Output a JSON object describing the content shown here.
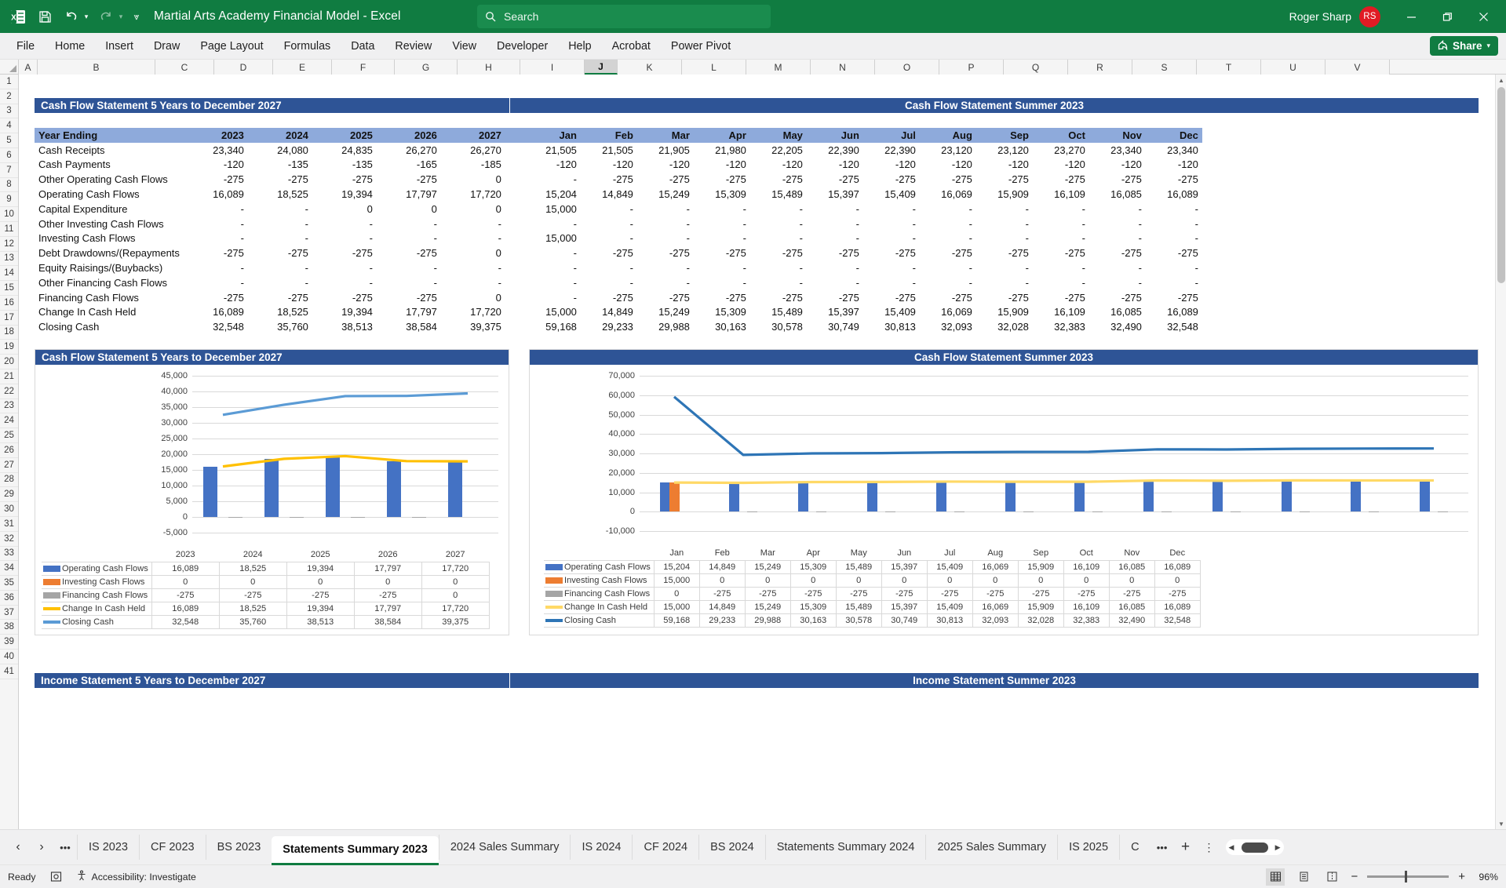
{
  "app": {
    "title": "Martial Arts Academy Financial Model  -  Excel",
    "search_placeholder": "Search",
    "user_name": "Roger Sharp",
    "user_initials": "RS",
    "qat": [
      "save-icon",
      "undo-icon",
      "redo-icon",
      "customize-icon"
    ],
    "window_buttons": [
      "minimize",
      "restore",
      "close"
    ]
  },
  "ribbon": {
    "tabs": [
      "File",
      "Home",
      "Insert",
      "Draw",
      "Page Layout",
      "Formulas",
      "Data",
      "Review",
      "View",
      "Developer",
      "Help",
      "Acrobat",
      "Power Pivot"
    ],
    "share_label": "Share"
  },
  "grid": {
    "columns": [
      "A",
      "B",
      "C",
      "D",
      "E",
      "F",
      "G",
      "H",
      "I",
      "J",
      "K",
      "L",
      "M",
      "N",
      "O",
      "P",
      "Q",
      "R",
      "S",
      "T",
      "U",
      "V"
    ],
    "selected_column": "J",
    "rows": [
      1,
      2,
      3,
      4,
      5,
      6,
      7,
      8,
      9,
      10,
      11,
      12,
      13,
      14,
      15,
      16,
      17,
      18,
      19,
      20,
      21,
      22,
      23,
      24,
      25,
      26,
      27,
      28,
      29,
      30,
      31,
      32,
      33,
      34,
      35,
      36,
      37,
      38,
      39,
      40,
      41
    ]
  },
  "banners": {
    "left_banner": "Cash Flow Statement 5 Years to December 2027",
    "right_banner": "Cash Flow Statement Summer 2023",
    "bottom_left_banner": "Income Statement 5 Years to December 2027",
    "bottom_right_banner": "Income Statement Summer 2023"
  },
  "table": {
    "header_label": "Year Ending",
    "year_columns": [
      "2023",
      "2024",
      "2025",
      "2026",
      "2027"
    ],
    "month_columns": [
      "Jan",
      "Feb",
      "Mar",
      "Apr",
      "May",
      "Jun",
      "Jul",
      "Aug",
      "Sep",
      "Oct",
      "Nov",
      "Dec"
    ],
    "rows": [
      {
        "label": "Cash Receipts",
        "years": [
          "23,340",
          "24,080",
          "24,835",
          "26,270",
          "26,270"
        ],
        "months": [
          "21,505",
          "21,505",
          "21,905",
          "21,980",
          "22,205",
          "22,390",
          "22,390",
          "23,120",
          "23,120",
          "23,270",
          "23,340",
          "23,340"
        ]
      },
      {
        "label": "Cash Payments",
        "years": [
          "-120",
          "-135",
          "-135",
          "-165",
          "-185"
        ],
        "months": [
          "-120",
          "-120",
          "-120",
          "-120",
          "-120",
          "-120",
          "-120",
          "-120",
          "-120",
          "-120",
          "-120",
          "-120"
        ]
      },
      {
        "label": "Other Operating Cash Flows",
        "years": [
          "-275",
          "-275",
          "-275",
          "-275",
          "0"
        ],
        "months": [
          "-",
          "-275",
          "-275",
          "-275",
          "-275",
          "-275",
          "-275",
          "-275",
          "-275",
          "-275",
          "-275",
          "-275"
        ]
      },
      {
        "label": "Operating Cash Flows",
        "years": [
          "16,089",
          "18,525",
          "19,394",
          "17,797",
          "17,720"
        ],
        "months": [
          "15,204",
          "14,849",
          "15,249",
          "15,309",
          "15,489",
          "15,397",
          "15,409",
          "16,069",
          "15,909",
          "16,109",
          "16,085",
          "16,089"
        ]
      },
      {
        "label": "Capital Expenditure",
        "years": [
          "-",
          "-",
          "0",
          "0",
          "0"
        ],
        "months": [
          "15,000",
          "-",
          "-",
          "-",
          "-",
          "-",
          "-",
          "-",
          "-",
          "-",
          "-",
          "-"
        ]
      },
      {
        "label": "Other Investing Cash Flows",
        "years": [
          "-",
          "-",
          "-",
          "-",
          "-"
        ],
        "months": [
          "-",
          "-",
          "-",
          "-",
          "-",
          "-",
          "-",
          "-",
          "-",
          "-",
          "-",
          "-"
        ]
      },
      {
        "label": "Investing Cash Flows",
        "years": [
          "-",
          "-",
          "-",
          "-",
          "-"
        ],
        "months": [
          "15,000",
          "-",
          "-",
          "-",
          "-",
          "-",
          "-",
          "-",
          "-",
          "-",
          "-",
          "-"
        ]
      },
      {
        "label": "Debt Drawdowns/(Repayments",
        "years": [
          "-275",
          "-275",
          "-275",
          "-275",
          "0"
        ],
        "months": [
          "-",
          "-275",
          "-275",
          "-275",
          "-275",
          "-275",
          "-275",
          "-275",
          "-275",
          "-275",
          "-275",
          "-275"
        ]
      },
      {
        "label": "Equity Raisings/(Buybacks)",
        "years": [
          "-",
          "-",
          "-",
          "-",
          "-"
        ],
        "months": [
          "-",
          "-",
          "-",
          "-",
          "-",
          "-",
          "-",
          "-",
          "-",
          "-",
          "-",
          "-"
        ]
      },
      {
        "label": "Other Financing Cash Flows",
        "years": [
          "-",
          "-",
          "-",
          "-",
          "-"
        ],
        "months": [
          "-",
          "-",
          "-",
          "-",
          "-",
          "-",
          "-",
          "-",
          "-",
          "-",
          "-",
          "-"
        ]
      },
      {
        "label": "Financing Cash Flows",
        "years": [
          "-275",
          "-275",
          "-275",
          "-275",
          "0"
        ],
        "months": [
          "-",
          "-275",
          "-275",
          "-275",
          "-275",
          "-275",
          "-275",
          "-275",
          "-275",
          "-275",
          "-275",
          "-275"
        ]
      },
      {
        "label": "Change In Cash Held",
        "years": [
          "16,089",
          "18,525",
          "19,394",
          "17,797",
          "17,720"
        ],
        "months": [
          "15,000",
          "14,849",
          "15,249",
          "15,309",
          "15,489",
          "15,397",
          "15,409",
          "16,069",
          "15,909",
          "16,109",
          "16,085",
          "16,089"
        ]
      },
      {
        "label": "Closing Cash",
        "years": [
          "32,548",
          "35,760",
          "38,513",
          "38,584",
          "39,375"
        ],
        "months": [
          "59,168",
          "29,233",
          "29,988",
          "30,163",
          "30,578",
          "30,749",
          "30,813",
          "32,093",
          "32,028",
          "32,383",
          "32,490",
          "32,548"
        ]
      }
    ]
  },
  "chart_data": [
    {
      "type": "bar",
      "title": "Cash Flow Statement 5 Years to December 2027",
      "categories": [
        "2023",
        "2024",
        "2025",
        "2026",
        "2027"
      ],
      "xlabel": "",
      "ylabel": "",
      "ylim": [
        -5000,
        45000
      ],
      "yticks": [
        "-5,000",
        "0",
        "5,000",
        "10,000",
        "15,000",
        "20,000",
        "25,000",
        "30,000",
        "35,000",
        "40,000",
        "45,000"
      ],
      "grid": true,
      "legend": "data-table",
      "series": [
        {
          "name": "Operating Cash Flows",
          "kind": "bar",
          "color": "#4472c4",
          "values": [
            16089,
            18525,
            19394,
            17797,
            17720
          ],
          "display": [
            "16,089",
            "18,525",
            "19,394",
            "17,797",
            "17,720"
          ]
        },
        {
          "name": "Investing Cash Flows",
          "kind": "bar",
          "color": "#ed7d31",
          "values": [
            0,
            0,
            0,
            0,
            0
          ],
          "display": [
            "0",
            "0",
            "0",
            "0",
            "0"
          ]
        },
        {
          "name": "Financing Cash Flows",
          "kind": "bar",
          "color": "#a5a5a5",
          "values": [
            -275,
            -275,
            -275,
            -275,
            0
          ],
          "display": [
            "-275",
            "-275",
            "-275",
            "-275",
            "0"
          ]
        },
        {
          "name": "Change In Cash Held",
          "kind": "line",
          "color": "#ffc000",
          "values": [
            16089,
            18525,
            19394,
            17797,
            17720
          ],
          "display": [
            "16,089",
            "18,525",
            "19,394",
            "17,797",
            "17,720"
          ]
        },
        {
          "name": "Closing Cash",
          "kind": "line",
          "color": "#5b9bd5",
          "values": [
            32548,
            35760,
            38513,
            38584,
            39375
          ],
          "display": [
            "32,548",
            "35,760",
            "38,513",
            "38,584",
            "39,375"
          ]
        }
      ]
    },
    {
      "type": "bar",
      "title": "Cash Flow Statement Summer 2023",
      "categories": [
        "Jan",
        "Feb",
        "Mar",
        "Apr",
        "May",
        "Jun",
        "Jul",
        "Aug",
        "Sep",
        "Oct",
        "Nov",
        "Dec"
      ],
      "xlabel": "",
      "ylabel": "",
      "ylim": [
        -10000,
        70000
      ],
      "yticks": [
        "-10,000",
        "0",
        "10,000",
        "20,000",
        "30,000",
        "40,000",
        "50,000",
        "60,000",
        "70,000"
      ],
      "grid": true,
      "legend": "data-table",
      "series": [
        {
          "name": "Operating Cash Flows",
          "kind": "bar",
          "color": "#4472c4",
          "values": [
            15204,
            14849,
            15249,
            15309,
            15489,
            15397,
            15409,
            16069,
            15909,
            16109,
            16085,
            16089
          ],
          "display": [
            "15,204",
            "14,849",
            "15,249",
            "15,309",
            "15,489",
            "15,397",
            "15,409",
            "16,069",
            "15,909",
            "16,109",
            "16,085",
            "16,089"
          ]
        },
        {
          "name": "Investing Cash Flows",
          "kind": "bar",
          "color": "#ed7d31",
          "values": [
            15000,
            0,
            0,
            0,
            0,
            0,
            0,
            0,
            0,
            0,
            0,
            0
          ],
          "display": [
            "15,000",
            "0",
            "0",
            "0",
            "0",
            "0",
            "0",
            "0",
            "0",
            "0",
            "0",
            "0"
          ]
        },
        {
          "name": "Financing Cash Flows",
          "kind": "bar",
          "color": "#a5a5a5",
          "values": [
            0,
            -275,
            -275,
            -275,
            -275,
            -275,
            -275,
            -275,
            -275,
            -275,
            -275,
            -275
          ],
          "display": [
            "0",
            "-275",
            "-275",
            "-275",
            "-275",
            "-275",
            "-275",
            "-275",
            "-275",
            "-275",
            "-275",
            "-275"
          ]
        },
        {
          "name": "Change In Cash Held",
          "kind": "line",
          "color": "#ffd966",
          "values": [
            15000,
            14849,
            15249,
            15309,
            15489,
            15397,
            15409,
            16069,
            15909,
            16109,
            16085,
            16089
          ],
          "display": [
            "15,000",
            "14,849",
            "15,249",
            "15,309",
            "15,489",
            "15,397",
            "15,409",
            "16,069",
            "15,909",
            "16,109",
            "16,085",
            "16,089"
          ]
        },
        {
          "name": "Closing Cash",
          "kind": "line",
          "color": "#2e75b6",
          "values": [
            59168,
            29233,
            29988,
            30163,
            30578,
            30749,
            30813,
            32093,
            32028,
            32383,
            32490,
            32548
          ],
          "display": [
            "59,168",
            "29,233",
            "29,988",
            "30,163",
            "30,578",
            "30,749",
            "30,813",
            "32,093",
            "32,028",
            "32,383",
            "32,490",
            "32,548"
          ]
        }
      ]
    }
  ],
  "sheet_tabs": {
    "items": [
      "IS 2023",
      "CF 2023",
      "BS 2023",
      "Statements Summary 2023",
      "2024 Sales Summary",
      "IS 2024",
      "CF 2024",
      "BS 2024",
      "Statements Summary 2024",
      "2025 Sales Summary",
      "IS 2025",
      "C"
    ],
    "active": "Statements Summary 2023",
    "add_label": "+"
  },
  "status": {
    "state": "Ready",
    "accessibility": "Accessibility: Investigate",
    "zoom": "96%",
    "zoom_out": "−",
    "zoom_in": "+"
  }
}
